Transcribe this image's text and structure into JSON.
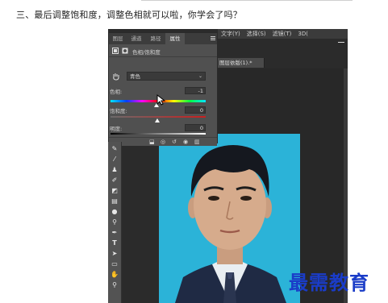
{
  "heading": "三、最后调整饱和度，调整色相就可以啦，你学会了吗？",
  "menubar": {
    "items": [
      "文字(Y)",
      "选择(S)",
      "滤镜(T)",
      "3D("
    ]
  },
  "document_tab": "图层依版(1).*",
  "properties_panel": {
    "tabs": [
      "图层",
      "通道",
      "路径",
      "属性"
    ],
    "active_tab": "属性",
    "title": "色相/饱和度",
    "preset_value": "青色",
    "hue_label": "色相:",
    "hue_value": "-1",
    "saturation_label": "饱和度:",
    "saturation_value": "0",
    "lightness_label": "明度:",
    "lightness_value": "0"
  },
  "watermark": "最需教育",
  "colors": {
    "photo_background": "#2bb3d8",
    "watermark": "#1a3cc8",
    "panel": "#505050",
    "workspace": "#282828"
  }
}
